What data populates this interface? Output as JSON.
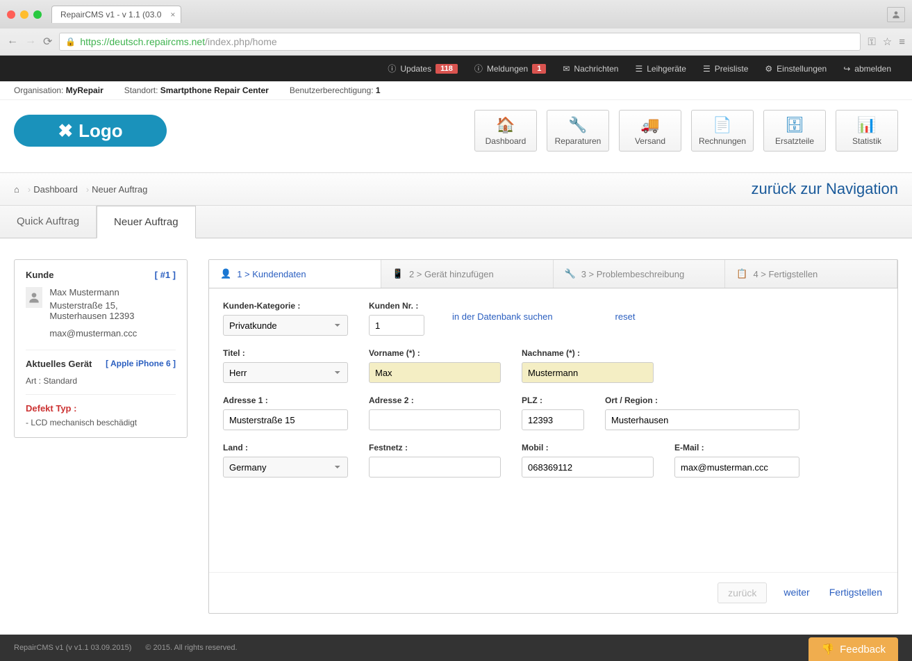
{
  "browser": {
    "tab_title": "RepairCMS v1 - v 1.1 (03.0",
    "url_secure": "https://deutsch.repaircms.net",
    "url_path": "/index.php/home"
  },
  "topnav": {
    "updates": "Updates",
    "updates_badge": "118",
    "meldungen": "Meldungen",
    "meldungen_badge": "1",
    "nachrichten": "Nachrichten",
    "leihgeraete": "Leihgeräte",
    "preisliste": "Preisliste",
    "einstellungen": "Einstellungen",
    "abmelden": "abmelden"
  },
  "inforow": {
    "org_label": "Organisation:",
    "org_value": "MyRepair",
    "loc_label": "Standort:",
    "loc_value": "Smartpthone Repair Center",
    "role_label": "Benutzerberechtigung:",
    "role_value": "1"
  },
  "logo_text": "Logo",
  "tiles": {
    "dashboard": "Dashboard",
    "reparaturen": "Reparaturen",
    "versand": "Versand",
    "rechnungen": "Rechnungen",
    "ersatzteile": "Ersatzteile",
    "statistik": "Statistik"
  },
  "breadcrumb": {
    "dashboard": "Dashboard",
    "current": "Neuer Auftrag",
    "back": "zurück zur Navigation"
  },
  "maintabs": {
    "quick": "Quick Auftrag",
    "neuer": "Neuer Auftrag"
  },
  "sidebar": {
    "kunde_label": "Kunde",
    "kunde_id": "[ #1 ]",
    "name": "Max Mustermann",
    "addr": "Musterstraße 15, Musterhausen 12393",
    "email": "max@musterman.ccc",
    "device_label": "Aktuelles Gerät",
    "device_id": "[ Apple iPhone 6 ]",
    "device_type": "Art : Standard",
    "defekt_label": "Defekt Typ :",
    "defekt_item": "- LCD mechanisch beschädigt"
  },
  "steps": {
    "s1": "1 > Kundendaten",
    "s2": "2 > Gerät hinzufügen",
    "s3": "3 > Problembeschreibung",
    "s4": "4 > Fertigstellen"
  },
  "form": {
    "category_label": "Kunden-Kategorie :",
    "category_value": "Privatkunde",
    "nr_label": "Kunden Nr. :",
    "nr_value": "1",
    "db_search": "in der Datenbank suchen",
    "reset": "reset",
    "titel_label": "Titel :",
    "titel_value": "Herr",
    "vorname_label": "Vorname (*) :",
    "vorname_value": "Max",
    "nachname_label": "Nachname (*) :",
    "nachname_value": "Mustermann",
    "addr1_label": "Adresse 1 :",
    "addr1_value": "Musterstraße 15",
    "addr2_label": "Adresse 2 :",
    "addr2_value": "",
    "plz_label": "PLZ :",
    "plz_value": "12393",
    "ort_label": "Ort / Region :",
    "ort_value": "Musterhausen",
    "land_label": "Land :",
    "land_value": "Germany",
    "festnetz_label": "Festnetz :",
    "festnetz_value": "",
    "mobil_label": "Mobil :",
    "mobil_value": "068369112",
    "email_label": "E-Mail :",
    "email_value": "max@musterman.ccc"
  },
  "actions": {
    "zurueck": "zurück",
    "weiter": "weiter",
    "fertigstellen": "Fertigstellen"
  },
  "footer": {
    "version": "RepairCMS v1 (v v1.1 03.09.2015)",
    "copyright": "© 2015. All rights reserved.",
    "feedback": "Feedback"
  }
}
